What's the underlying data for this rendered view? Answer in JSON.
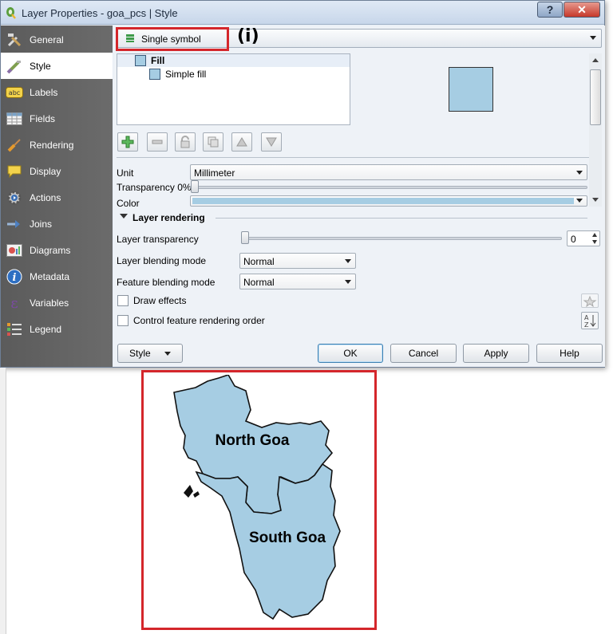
{
  "window": {
    "title": "Layer Properties - goa_pcs | Style",
    "help_button": "?",
    "close_button": "✕"
  },
  "nav": {
    "items": [
      {
        "label": "General",
        "icon": "wrench-hammer-icon"
      },
      {
        "label": "Style",
        "icon": "paintbrush-icon",
        "active": true
      },
      {
        "label": "Labels",
        "icon": "abc-label-icon"
      },
      {
        "label": "Fields",
        "icon": "table-fields-icon"
      },
      {
        "label": "Rendering",
        "icon": "brush-icon"
      },
      {
        "label": "Display",
        "icon": "speech-bubble-icon"
      },
      {
        "label": "Actions",
        "icon": "gear-play-icon"
      },
      {
        "label": "Joins",
        "icon": "join-arrow-icon"
      },
      {
        "label": "Diagrams",
        "icon": "pie-diagram-icon"
      },
      {
        "label": "Metadata",
        "icon": "info-icon"
      },
      {
        "label": "Variables",
        "icon": "epsilon-icon"
      },
      {
        "label": "Legend",
        "icon": "legend-list-icon"
      }
    ]
  },
  "style": {
    "renderer": "Single symbol",
    "annotation": "(i)",
    "tree": {
      "root": "Fill",
      "child": "Simple fill"
    },
    "fill_color": "#a6cde3",
    "unit_label": "Unit",
    "unit_value": "Millimeter",
    "transparency_label": "Transparency 0%",
    "color_label": "Color"
  },
  "layer_rendering": {
    "section_title": "Layer rendering",
    "transparency_label": "Layer transparency",
    "transparency_value": "0",
    "blending_label": "Layer blending mode",
    "blending_value": "Normal",
    "feature_blending_label": "Feature blending mode",
    "feature_blending_value": "Normal",
    "draw_effects_label": "Draw effects",
    "control_order_label": "Control feature rendering order"
  },
  "buttons": {
    "style": "Style",
    "ok": "OK",
    "cancel": "Cancel",
    "apply": "Apply",
    "help": "Help"
  },
  "map": {
    "north_label": "North Goa",
    "south_label": "South Goa",
    "fill_color": "#a6cde3",
    "frame_color": "#d4262b"
  }
}
